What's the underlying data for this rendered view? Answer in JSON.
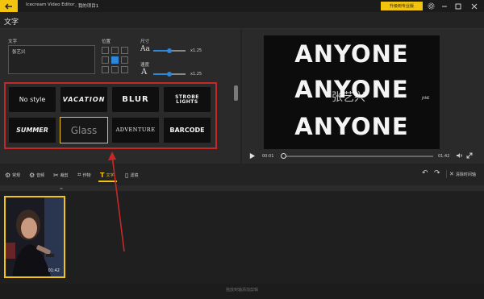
{
  "titlebar": {
    "app_title": "Icecream Video Editor",
    "doc_title": "- 我的项目1",
    "upgrade_label": "升级到专业版",
    "icons": [
      "back-arrow-icon",
      "gear-icon",
      "minimize-icon",
      "maximize-icon",
      "close-icon"
    ]
  },
  "section_title": "文字",
  "text_panel": {
    "text_label": "文字",
    "text_value": "张艺兴",
    "position_label": "位置",
    "size_label": "尺寸",
    "speed_label": "速度",
    "size_icon": "Aa",
    "speed_icon": "A",
    "size_value": "x1.25",
    "speed_value": "x1.25",
    "size_level": 0.5,
    "speed_level": 0.5,
    "position_selected": "center"
  },
  "styles": [
    {
      "label": "No style",
      "selected": false
    },
    {
      "label": "VACATION",
      "selected": false
    },
    {
      "label": "BLUR",
      "selected": false
    },
    {
      "label": "STROBE LIGHTS",
      "selected": false
    },
    {
      "label": "SUMMER",
      "selected": false
    },
    {
      "label": "Glass",
      "selected": true
    },
    {
      "label": "ADVENTURE",
      "selected": false
    },
    {
      "label": "BARCODE",
      "selected": false
    }
  ],
  "preview": {
    "line1": "ANYONE",
    "line2": "ANYONE",
    "line3": "ANYONE",
    "overlay_text": "张艺兴",
    "small_label": "JANE",
    "time_current": "00:01",
    "time_total": "01:42",
    "progress": 0.01
  },
  "toolbar": {
    "items": [
      {
        "label": "常规",
        "icon": "gear-icon"
      },
      {
        "label": "音频",
        "icon": "audio-settings-icon"
      },
      {
        "label": "裁剪",
        "icon": "crop-icon"
      },
      {
        "label": "作物",
        "icon": "crop-frame-icon"
      },
      {
        "label": "文字",
        "icon": "text-T-icon"
      },
      {
        "label": "滤镜",
        "icon": "filter-icon"
      }
    ],
    "clear_label": "清除时间轴"
  },
  "timeline": {
    "clip_duration": "01:42"
  },
  "status": {
    "text": "拖放到轴添加剪辑"
  },
  "colors": {
    "accent": "#f2c40f",
    "annotation": "#c62828",
    "selected_blue": "#2e87d8"
  }
}
